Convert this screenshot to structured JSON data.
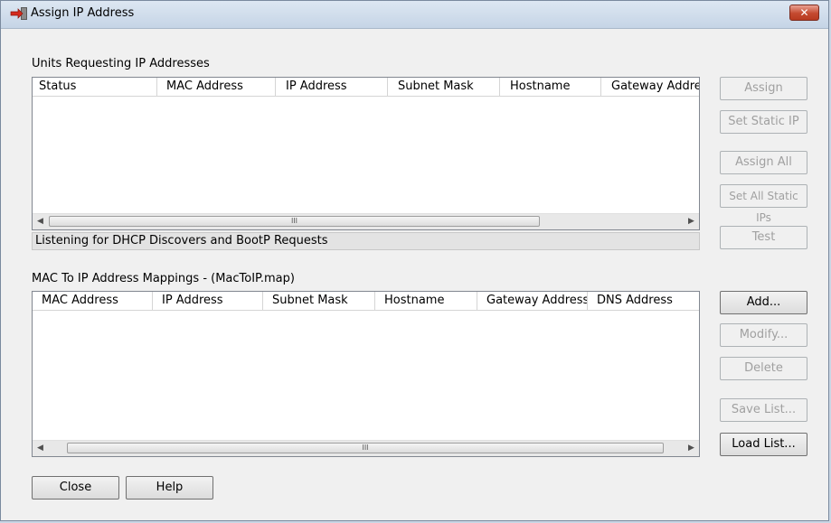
{
  "window": {
    "title": "Assign IP Address",
    "close_label": "✕"
  },
  "requests": {
    "group_label": "Units Requesting IP Addresses",
    "columns": [
      "Status",
      "MAC Address",
      "IP Address",
      "Subnet Mask",
      "Hostname",
      "Gateway Addres"
    ],
    "rows": [],
    "scroll_grip": "III",
    "status_text": "Listening for DHCP Discovers and BootP Requests"
  },
  "mappings": {
    "group_label": "MAC To IP Address Mappings - (MacToIP.map)",
    "columns": [
      "MAC Address",
      "IP Address",
      "Subnet Mask",
      "Hostname",
      "Gateway Address",
      "DNS Address"
    ],
    "rows": [],
    "scroll_grip": "III"
  },
  "buttons": {
    "assign": "Assign",
    "set_static_ip": "Set Static IP",
    "assign_all": "Assign All",
    "set_all_static_ips": "Set All Static IPs",
    "test": "Test",
    "add": "Add...",
    "modify": "Modify...",
    "delete": "Delete",
    "save_list": "Save List...",
    "load_list": "Load List...",
    "close": "Close",
    "help": "Help"
  },
  "icons": {
    "title_icon": "network-arrow-icon",
    "scroll_left": "◀",
    "scroll_right": "▶"
  }
}
